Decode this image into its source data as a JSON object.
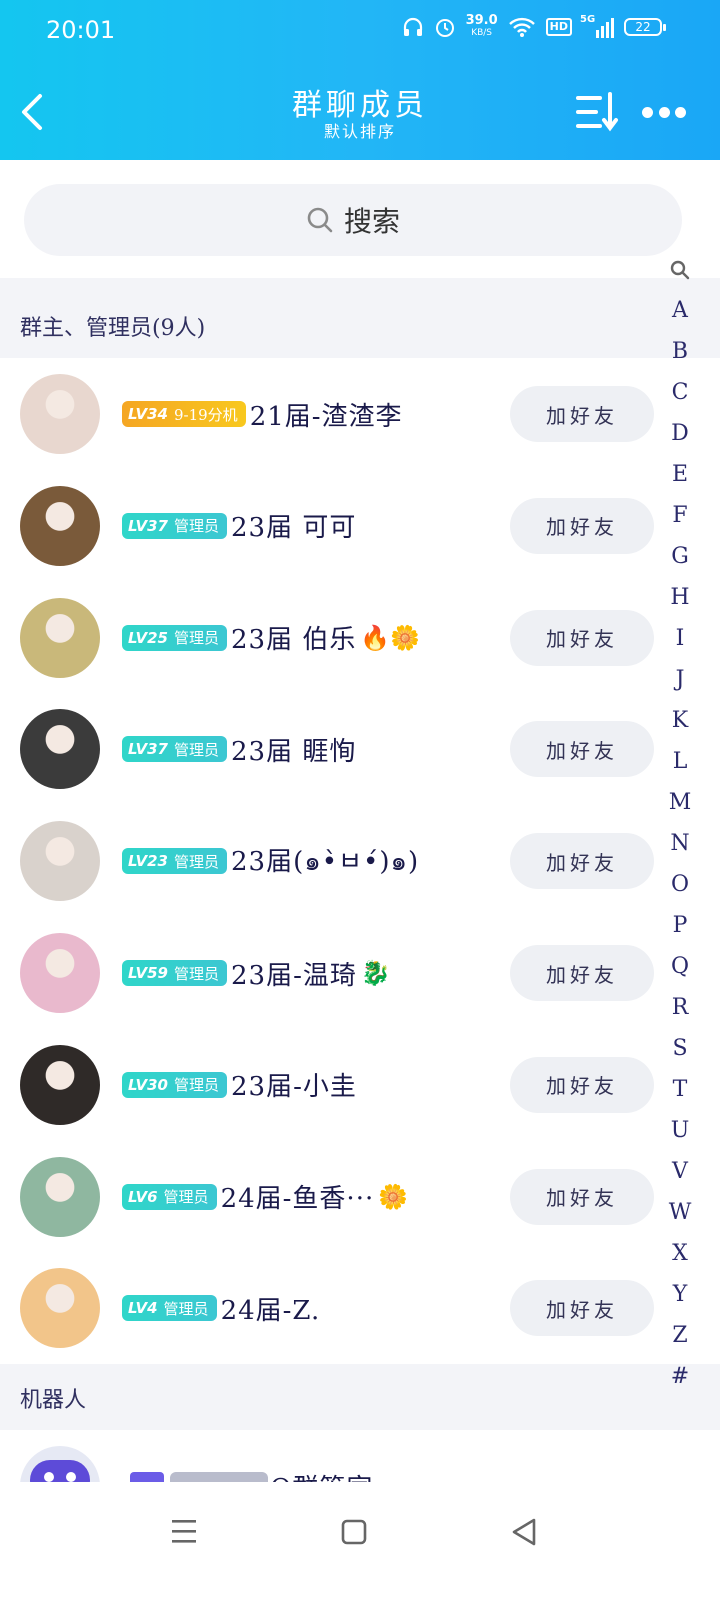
{
  "status_bar": {
    "time": "20:01",
    "net_speed_value": "39.0",
    "net_speed_unit": "KB/S",
    "hd_label": "HD",
    "signal_label": "5G",
    "battery": "22"
  },
  "header": {
    "title": "群聊成员",
    "subtitle": "默认排序"
  },
  "search": {
    "placeholder": "搜索"
  },
  "sections": {
    "admins": "群主、管理员(9人)",
    "bots": "机器人"
  },
  "add_friend_label": "加好友",
  "members": [
    {
      "level": "LV34",
      "role": "9-19分机",
      "name": "21届-渣渣李",
      "emoji": "",
      "badge_style": "gold",
      "avatar_color": "#e8d7cf"
    },
    {
      "level": "LV37",
      "role": "管理员",
      "name": "23届  可可",
      "emoji": "",
      "badge_style": "teal",
      "avatar_color": "#7a5a3a"
    },
    {
      "level": "LV25",
      "role": "管理员",
      "name": "23届 伯乐",
      "emoji": "🔥🌼",
      "badge_style": "teal",
      "avatar_color": "#c9b87a"
    },
    {
      "level": "LV37",
      "role": "管理员",
      "name": "23届 睚恂",
      "emoji": "",
      "badge_style": "teal",
      "avatar_color": "#3b3b3b"
    },
    {
      "level": "LV23",
      "role": "管理员",
      "name": "23届(๑•̀ㅂ•́)๑)",
      "emoji": "",
      "badge_style": "teal",
      "avatar_color": "#d9d2cc"
    },
    {
      "level": "LV59",
      "role": "管理员",
      "name": "23届-温琦",
      "emoji": "🐉",
      "badge_style": "teal",
      "avatar_color": "#e9b9cd"
    },
    {
      "level": "LV30",
      "role": "管理员",
      "name": "23届-小圭",
      "emoji": "",
      "badge_style": "teal",
      "avatar_color": "#2f2a28"
    },
    {
      "level": "LV6",
      "role": "管理员",
      "name": "24届-鱼香···",
      "emoji": "🌼",
      "badge_style": "teal",
      "avatar_color": "#8fb7a0"
    },
    {
      "level": "LV4",
      "role": "管理员",
      "name": "24届-Z.",
      "emoji": "",
      "badge_style": "teal",
      "avatar_color": "#f2c58a"
    }
  ],
  "bot": {
    "name": "Q群管家",
    "avatar_color": "#5d4bd8"
  },
  "index_letters": [
    "A",
    "B",
    "C",
    "D",
    "E",
    "F",
    "G",
    "H",
    "I",
    "J",
    "K",
    "L",
    "M",
    "N",
    "O",
    "P",
    "Q",
    "R",
    "S",
    "T",
    "U",
    "V",
    "W",
    "X",
    "Y",
    "Z",
    "#"
  ]
}
